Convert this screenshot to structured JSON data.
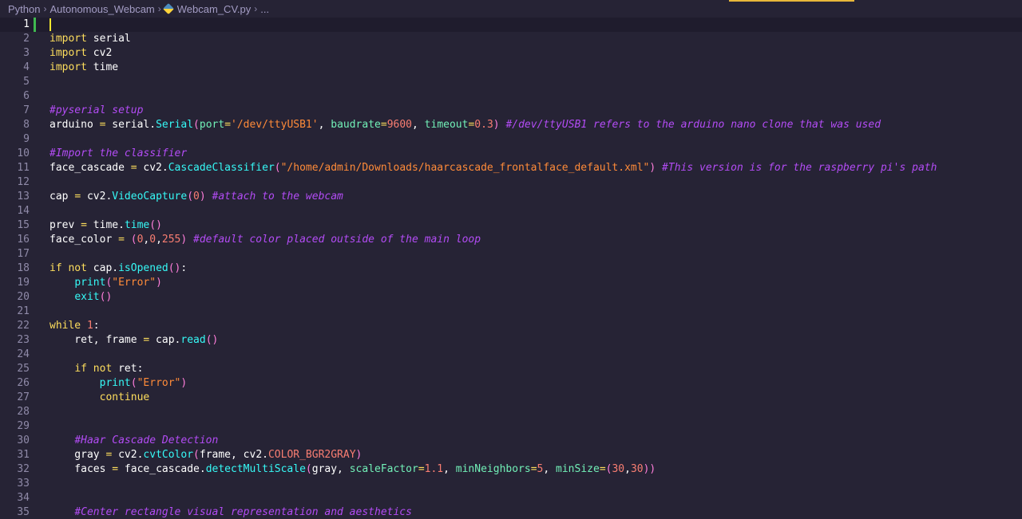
{
  "breadcrumb": {
    "items": [
      "Python",
      "Autonomous_Webcam",
      "Webcam_CV.py",
      "..."
    ],
    "separator": "›"
  },
  "editor": {
    "active_line": 1,
    "line_numbers": [
      "1",
      "2",
      "3",
      "4",
      "5",
      "6",
      "7",
      "8",
      "9",
      "10",
      "11",
      "12",
      "13",
      "14",
      "15",
      "16",
      "17",
      "18",
      "19",
      "20",
      "21",
      "22",
      "23",
      "24",
      "25",
      "26",
      "27",
      "28",
      "29",
      "30",
      "31",
      "32",
      "33",
      "34",
      "35"
    ],
    "lines": [
      [],
      [
        {
          "t": "kw",
          "v": "import"
        },
        {
          "t": "plain",
          "v": " serial"
        }
      ],
      [
        {
          "t": "kw",
          "v": "import"
        },
        {
          "t": "plain",
          "v": " cv2"
        }
      ],
      [
        {
          "t": "kw",
          "v": "import"
        },
        {
          "t": "plain",
          "v": " time"
        }
      ],
      [],
      [],
      [
        {
          "t": "cm",
          "v": "#pyserial setup"
        }
      ],
      [
        {
          "t": "plain",
          "v": "arduino "
        },
        {
          "t": "op",
          "v": "="
        },
        {
          "t": "plain",
          "v": " serial."
        },
        {
          "t": "fn",
          "v": "Serial"
        },
        {
          "t": "paren",
          "v": "("
        },
        {
          "t": "param",
          "v": "port"
        },
        {
          "t": "op",
          "v": "="
        },
        {
          "t": "str",
          "v": "'/dev/ttyUSB1'"
        },
        {
          "t": "plain",
          "v": ", "
        },
        {
          "t": "param",
          "v": "baudrate"
        },
        {
          "t": "op",
          "v": "="
        },
        {
          "t": "num",
          "v": "9600"
        },
        {
          "t": "plain",
          "v": ", "
        },
        {
          "t": "param",
          "v": "timeout"
        },
        {
          "t": "op",
          "v": "="
        },
        {
          "t": "num",
          "v": "0.3"
        },
        {
          "t": "paren",
          "v": ")"
        },
        {
          "t": "plain",
          "v": " "
        },
        {
          "t": "cm",
          "v": "#/dev/ttyUSB1 refers to the arduino nano clone that was used"
        }
      ],
      [],
      [
        {
          "t": "cm",
          "v": "#Import the classifier"
        }
      ],
      [
        {
          "t": "plain",
          "v": "face_cascade "
        },
        {
          "t": "op",
          "v": "="
        },
        {
          "t": "plain",
          "v": " cv2."
        },
        {
          "t": "fn",
          "v": "CascadeClassifier"
        },
        {
          "t": "paren",
          "v": "("
        },
        {
          "t": "str",
          "v": "\"/home/admin/Downloads/haarcascade_frontalface_default.xml\""
        },
        {
          "t": "paren",
          "v": ")"
        },
        {
          "t": "plain",
          "v": " "
        },
        {
          "t": "cm",
          "v": "#This version is for the raspberry pi's path"
        }
      ],
      [],
      [
        {
          "t": "plain",
          "v": "cap "
        },
        {
          "t": "op",
          "v": "="
        },
        {
          "t": "plain",
          "v": " cv2."
        },
        {
          "t": "fn",
          "v": "VideoCapture"
        },
        {
          "t": "paren",
          "v": "("
        },
        {
          "t": "num",
          "v": "0"
        },
        {
          "t": "paren",
          "v": ")"
        },
        {
          "t": "plain",
          "v": " "
        },
        {
          "t": "cm",
          "v": "#attach to the webcam"
        }
      ],
      [],
      [
        {
          "t": "plain",
          "v": "prev "
        },
        {
          "t": "op",
          "v": "="
        },
        {
          "t": "plain",
          "v": " time."
        },
        {
          "t": "fn",
          "v": "time"
        },
        {
          "t": "paren",
          "v": "()"
        }
      ],
      [
        {
          "t": "plain",
          "v": "face_color "
        },
        {
          "t": "op",
          "v": "="
        },
        {
          "t": "plain",
          "v": " "
        },
        {
          "t": "paren",
          "v": "("
        },
        {
          "t": "num",
          "v": "0"
        },
        {
          "t": "plain",
          "v": ","
        },
        {
          "t": "num",
          "v": "0"
        },
        {
          "t": "plain",
          "v": ","
        },
        {
          "t": "num",
          "v": "255"
        },
        {
          "t": "paren",
          "v": ")"
        },
        {
          "t": "plain",
          "v": " "
        },
        {
          "t": "cm",
          "v": "#default color placed outside of the main loop"
        }
      ],
      [],
      [
        {
          "t": "kw",
          "v": "if"
        },
        {
          "t": "plain",
          "v": " "
        },
        {
          "t": "kw",
          "v": "not"
        },
        {
          "t": "plain",
          "v": " cap."
        },
        {
          "t": "fn",
          "v": "isOpened"
        },
        {
          "t": "paren",
          "v": "()"
        },
        {
          "t": "plain",
          "v": ":"
        }
      ],
      [
        {
          "t": "plain",
          "v": "    "
        },
        {
          "t": "fn",
          "v": "print"
        },
        {
          "t": "paren",
          "v": "("
        },
        {
          "t": "str",
          "v": "\"Error\""
        },
        {
          "t": "paren",
          "v": ")"
        }
      ],
      [
        {
          "t": "plain",
          "v": "    "
        },
        {
          "t": "fn",
          "v": "exit"
        },
        {
          "t": "paren",
          "v": "()"
        }
      ],
      [],
      [
        {
          "t": "kw",
          "v": "while"
        },
        {
          "t": "plain",
          "v": " "
        },
        {
          "t": "num",
          "v": "1"
        },
        {
          "t": "plain",
          "v": ":"
        }
      ],
      [
        {
          "t": "plain",
          "v": "    ret, frame "
        },
        {
          "t": "op",
          "v": "="
        },
        {
          "t": "plain",
          "v": " cap."
        },
        {
          "t": "fn",
          "v": "read"
        },
        {
          "t": "paren",
          "v": "()"
        }
      ],
      [],
      [
        {
          "t": "plain",
          "v": "    "
        },
        {
          "t": "kw",
          "v": "if"
        },
        {
          "t": "plain",
          "v": " "
        },
        {
          "t": "kw",
          "v": "not"
        },
        {
          "t": "plain",
          "v": " ret:"
        }
      ],
      [
        {
          "t": "plain",
          "v": "        "
        },
        {
          "t": "fn",
          "v": "print"
        },
        {
          "t": "paren",
          "v": "("
        },
        {
          "t": "str",
          "v": "\"Error\""
        },
        {
          "t": "paren",
          "v": ")"
        }
      ],
      [
        {
          "t": "plain",
          "v": "        "
        },
        {
          "t": "kw",
          "v": "continue"
        }
      ],
      [],
      [],
      [
        {
          "t": "plain",
          "v": "    "
        },
        {
          "t": "cm",
          "v": "#Haar Cascade Detection"
        }
      ],
      [
        {
          "t": "plain",
          "v": "    gray "
        },
        {
          "t": "op",
          "v": "="
        },
        {
          "t": "plain",
          "v": " cv2."
        },
        {
          "t": "fn",
          "v": "cvtColor"
        },
        {
          "t": "paren",
          "v": "("
        },
        {
          "t": "plain",
          "v": "frame, cv2."
        },
        {
          "t": "const",
          "v": "COLOR_BGR2GRAY"
        },
        {
          "t": "paren",
          "v": ")"
        }
      ],
      [
        {
          "t": "plain",
          "v": "    faces "
        },
        {
          "t": "op",
          "v": "="
        },
        {
          "t": "plain",
          "v": " face_cascade."
        },
        {
          "t": "fn",
          "v": "detectMultiScale"
        },
        {
          "t": "paren",
          "v": "("
        },
        {
          "t": "plain",
          "v": "gray, "
        },
        {
          "t": "param",
          "v": "scaleFactor"
        },
        {
          "t": "op",
          "v": "="
        },
        {
          "t": "num",
          "v": "1.1"
        },
        {
          "t": "plain",
          "v": ", "
        },
        {
          "t": "param",
          "v": "minNeighbors"
        },
        {
          "t": "op",
          "v": "="
        },
        {
          "t": "num",
          "v": "5"
        },
        {
          "t": "plain",
          "v": ", "
        },
        {
          "t": "param",
          "v": "minSize"
        },
        {
          "t": "op",
          "v": "="
        },
        {
          "t": "paren",
          "v": "("
        },
        {
          "t": "num",
          "v": "30"
        },
        {
          "t": "plain",
          "v": ","
        },
        {
          "t": "num",
          "v": "30"
        },
        {
          "t": "paren",
          "v": "))"
        }
      ],
      [],
      [],
      [
        {
          "t": "plain",
          "v": "    "
        },
        {
          "t": "cm",
          "v": "#Center rectangle visual representation and aesthetics"
        }
      ]
    ]
  },
  "colors": {
    "background": "#262335",
    "keyword": "#fede5d",
    "function": "#36f9f6",
    "string": "#ff8b39",
    "number": "#f97e72",
    "comment": "#b34cf5",
    "parameter": "#72f1b8",
    "paren": "#ff7edb",
    "line_number": "#8f8aa8",
    "cursor": "#f3e72e",
    "git_added": "#3fb950",
    "find_highlight": "#e8b73a"
  }
}
